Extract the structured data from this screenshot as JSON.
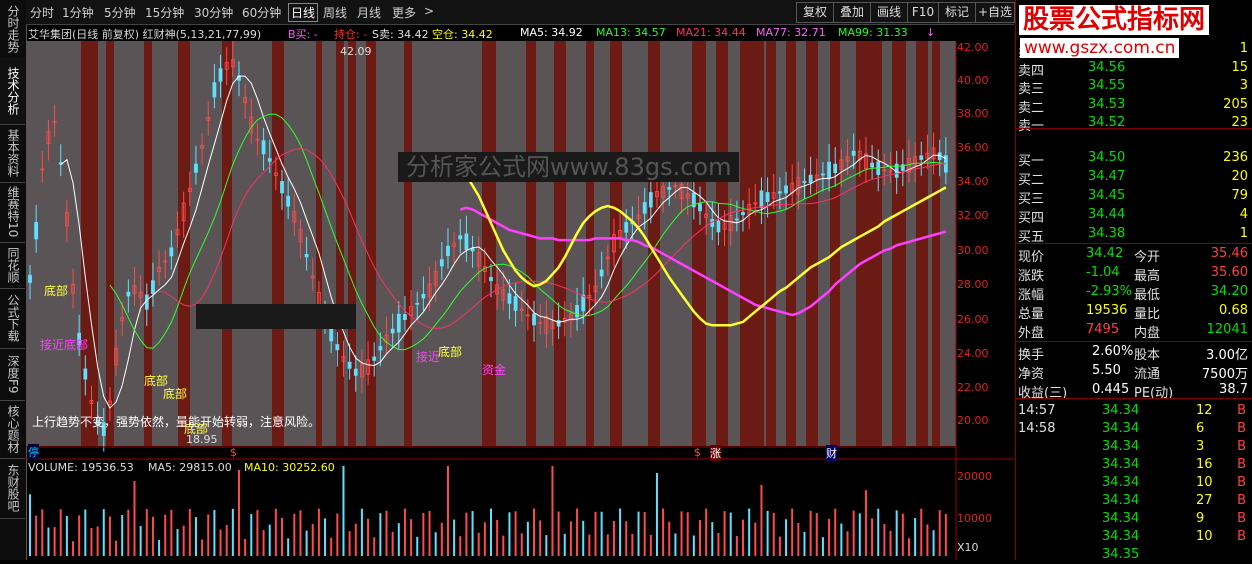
{
  "left_tabs": [
    {
      "label": "分时走势"
    },
    {
      "label": "技术分析"
    },
    {
      "label": "基本资料"
    },
    {
      "label": "维赛特10"
    },
    {
      "label": "同花顺"
    },
    {
      "label": "公式下载"
    },
    {
      "label": "深度F9"
    },
    {
      "label": "核心题材"
    },
    {
      "label": "东财股吧"
    }
  ],
  "toolbar": {
    "periods": [
      "分时",
      "1分钟",
      "5分钟",
      "15分钟",
      "30分钟",
      "60分钟",
      "日线",
      "周线",
      "月线",
      "更多"
    ],
    "selected": "日线",
    "more_arrow": ">",
    "right_buttons": [
      "复权",
      "叠加",
      "画线",
      "F10",
      "标记",
      "+自选"
    ]
  },
  "info": {
    "title": "艾华集团(日线 前复权) 红财神(5,13,21,77,99)",
    "b_buy": "B买: -",
    "hold": "持仓: -",
    "s_sell": "S卖: 34.42",
    "empty_pos": "空仓: 34.42",
    "ma5": "MA5: 34.92",
    "ma13": "MA13: 34.57",
    "ma21": "MA21: 34.44",
    "ma77": "MA77: 32.71",
    "ma99": "MA99: 31.33",
    "arrow_icon": "↓"
  },
  "price_axis": [
    "42.00",
    "40.00",
    "38.00",
    "36.00",
    "34.00",
    "32.00",
    "30.00",
    "28.00",
    "26.00",
    "24.00",
    "22.00",
    "20.00"
  ],
  "volume_axis": [
    "20000",
    "10000",
    "X10"
  ],
  "chart_labels": {
    "high": "42.09",
    "low": "18.95",
    "bottom1": "底部",
    "near_bottom": "接近底部",
    "bottom2": "底部",
    "bottom3": "底部",
    "bottom4": "底部",
    "near_bottom2": "接近",
    "bottom5": "底部",
    "capital": "资金",
    "trend_note": "上行趋势不变，强势依然，量能开始转弱，注意风险。",
    "marker_ting": "停",
    "marker_s1": "$",
    "marker_s2": "$",
    "marker_zhang": "涨",
    "marker_cai": "财"
  },
  "volume_info": {
    "volume": "VOLUME: 19536.53",
    "ma5": "MA5: 29815.00",
    "ma10": "MA10: 30252.60"
  },
  "watermark": {
    "logo": "股票公式指标网",
    "url": "www.gszx.com.cn",
    "center": "分析家公式网www.83gs.com"
  },
  "order_book": {
    "sell": [
      {
        "label": "卖五",
        "price": "34.58",
        "vol": "1"
      },
      {
        "label": "卖四",
        "price": "34.56",
        "vol": "15"
      },
      {
        "label": "卖三",
        "price": "34.55",
        "vol": "3"
      },
      {
        "label": "卖二",
        "price": "34.53",
        "vol": "205"
      },
      {
        "label": "卖一",
        "price": "34.52",
        "vol": "23"
      }
    ],
    "buy": [
      {
        "label": "买一",
        "price": "34.50",
        "vol": "236"
      },
      {
        "label": "买二",
        "price": "34.47",
        "vol": "20"
      },
      {
        "label": "买三",
        "price": "34.45",
        "vol": "79"
      },
      {
        "label": "买四",
        "price": "34.44",
        "vol": "4"
      },
      {
        "label": "买五",
        "price": "34.38",
        "vol": "1"
      }
    ]
  },
  "quote": [
    {
      "l1": "现价",
      "v1": "34.42",
      "l2": "今开",
      "v2": "35.46",
      "c1": "#00e000",
      "c2": "#ff4040"
    },
    {
      "l1": "涨跌",
      "v1": "-1.04",
      "l2": "最高",
      "v2": "35.60",
      "c1": "#00e000",
      "c2": "#ff4040"
    },
    {
      "l1": "涨幅",
      "v1": "-2.93%",
      "l2": "最低",
      "v2": "34.20",
      "c1": "#00e000",
      "c2": "#00e000"
    },
    {
      "l1": "总量",
      "v1": "19536",
      "l2": "量比",
      "v2": "0.68",
      "c1": "#ffff00",
      "c2": "#ffff00"
    },
    {
      "l1": "外盘",
      "v1": "7495",
      "l2": "内盘",
      "v2": "12041",
      "c1": "#ff4040",
      "c2": "#00e000"
    }
  ],
  "fundamentals": [
    {
      "l1": "换手",
      "v1": "2.60%",
      "l2": "股本",
      "v2": "3.00亿"
    },
    {
      "l1": "净资",
      "v1": "5.50",
      "l2": "流通",
      "v2": "7500万"
    },
    {
      "l1": "收益(三)",
      "v1": "0.445",
      "l2": "PE(动)",
      "v2": "38.7"
    }
  ],
  "ticks": [
    {
      "time": "14:57",
      "price": "34.34",
      "vol": "12",
      "side": "B"
    },
    {
      "time": "14:58",
      "price": "34.34",
      "vol": "6",
      "side": "B"
    },
    {
      "time": "",
      "price": "34.34",
      "vol": "3",
      "side": "B"
    },
    {
      "time": "",
      "price": "34.34",
      "vol": "16",
      "side": "B"
    },
    {
      "time": "",
      "price": "34.34",
      "vol": "10",
      "side": "B"
    },
    {
      "time": "",
      "price": "34.34",
      "vol": "27",
      "side": "B"
    },
    {
      "time": "",
      "price": "34.34",
      "vol": "9",
      "side": "B"
    },
    {
      "time": "",
      "price": "34.34",
      "vol": "10",
      "side": "B"
    },
    {
      "time": "",
      "price": "34.35",
      "vol": "",
      "side": ""
    }
  ],
  "chart_data": {
    "type": "line",
    "title": "艾华集团(日线 前复权)",
    "ylim": [
      19,
      42.5
    ],
    "series": [
      {
        "name": "MA77",
        "values": [
          null,
          null,
          null,
          null,
          null,
          null,
          null,
          null,
          null,
          null,
          null,
          null,
          null,
          null,
          null,
          null,
          null,
          null,
          null,
          null,
          null,
          null,
          null,
          null,
          null,
          null,
          null,
          null,
          null,
          null,
          null,
          null,
          null,
          null,
          null,
          null,
          null,
          null,
          null,
          null,
          null,
          null,
          null,
          null,
          null,
          null,
          null,
          null,
          null,
          null,
          null,
          null,
          null,
          null,
          null,
          null,
          null,
          null,
          null,
          null,
          null,
          null,
          null,
          null,
          null,
          null,
          null,
          null,
          null,
          null,
          32.6,
          32.7,
          32.6,
          32.4,
          32.2,
          32.0,
          31.8,
          31.6,
          31.4,
          31.3,
          31.2,
          31.1,
          31.0,
          30.9,
          30.9,
          30.9,
          30.8,
          30.8,
          30.8,
          30.8,
          30.8,
          30.8,
          30.9,
          30.9,
          30.9,
          30.9,
          30.9,
          30.8,
          30.8,
          30.7,
          30.5,
          30.4,
          30.2,
          30.0,
          29.8,
          29.6,
          29.4,
          29.2,
          29.0,
          28.8,
          28.6,
          28.4,
          28.2,
          28.0,
          27.8,
          27.6,
          27.4,
          27.2,
          27.0,
          26.9,
          26.8,
          26.7,
          26.6,
          26.5,
          26.4,
          26.5,
          26.7,
          26.9,
          27.2,
          27.5,
          27.8,
          28.2,
          28.5,
          28.8,
          29.1,
          29.4,
          29.6,
          29.8,
          30.0,
          30.2,
          30.3,
          30.5,
          30.6,
          30.7,
          30.8,
          30.9,
          31.0,
          31.1,
          31.2,
          31.3
        ]
      },
      {
        "name": "MA99",
        "values": [
          null,
          null,
          null,
          null,
          null,
          null,
          null,
          null,
          null,
          null,
          null,
          null,
          null,
          null,
          null,
          null,
          null,
          null,
          null,
          null,
          null,
          null,
          null,
          null,
          null,
          null,
          null,
          null,
          null,
          null,
          null,
          null,
          null,
          null,
          null,
          null,
          null,
          null,
          null,
          null,
          null,
          null,
          null,
          null,
          null,
          null,
          null,
          null,
          null,
          null,
          null,
          null,
          null,
          null,
          null,
          null,
          null,
          null,
          null,
          null,
          null,
          null,
          null,
          null,
          null,
          null,
          null,
          null,
          null,
          null,
          34.9,
          34.6,
          34.0,
          33.4,
          32.6,
          31.8,
          31.0,
          30.2,
          29.6,
          29.0,
          28.6,
          28.3,
          28.1,
          28.2,
          28.4,
          28.8,
          29.2,
          29.8,
          30.5,
          31.2,
          31.8,
          32.2,
          32.5,
          32.7,
          32.8,
          32.7,
          32.5,
          32.2,
          31.9,
          31.5,
          31.0,
          30.4,
          29.8,
          29.2,
          28.6,
          28.1,
          27.6,
          27.1,
          26.6,
          26.2,
          25.9,
          25.8,
          25.8,
          25.8,
          25.8,
          25.9,
          26.0,
          26.3,
          26.6,
          26.9,
          27.2,
          27.5,
          27.8,
          28.0,
          28.3,
          28.6,
          28.9,
          29.2,
          29.4,
          29.6,
          29.8,
          30.1,
          30.4,
          30.6,
          30.8,
          31.0,
          31.2,
          31.4,
          31.6,
          31.9,
          32.1,
          32.3,
          32.5,
          32.7,
          32.9,
          33.1,
          33.3,
          33.5,
          33.7,
          33.9
        ]
      }
    ]
  }
}
